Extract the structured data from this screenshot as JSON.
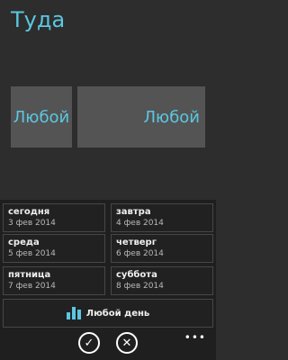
{
  "header": {
    "title": "Туда"
  },
  "tiles": {
    "left_label": "Любой",
    "right_label": "Любой"
  },
  "days": [
    {
      "name": "сегодня",
      "date": "3 фев 2014"
    },
    {
      "name": "завтра",
      "date": "4 фев 2014"
    },
    {
      "name": "среда",
      "date": "5 фев 2014"
    },
    {
      "name": "четверг",
      "date": "6 фев 2014"
    },
    {
      "name": "пятница",
      "date": "7 фев 2014"
    },
    {
      "name": "суббота",
      "date": "8 фев 2014"
    }
  ],
  "any_day": {
    "label": "Любой день",
    "icon": "bar-chart-icon"
  },
  "appbar": {
    "confirm_icon": "checkmark-icon",
    "cancel_icon": "close-icon",
    "confirm_glyph": "✓",
    "cancel_glyph": "✕",
    "more_glyph": "•••"
  },
  "colors": {
    "accent": "#5bc7e0",
    "background": "#2d2d2d",
    "panel": "#1f1f1f",
    "tile": "#545454"
  }
}
